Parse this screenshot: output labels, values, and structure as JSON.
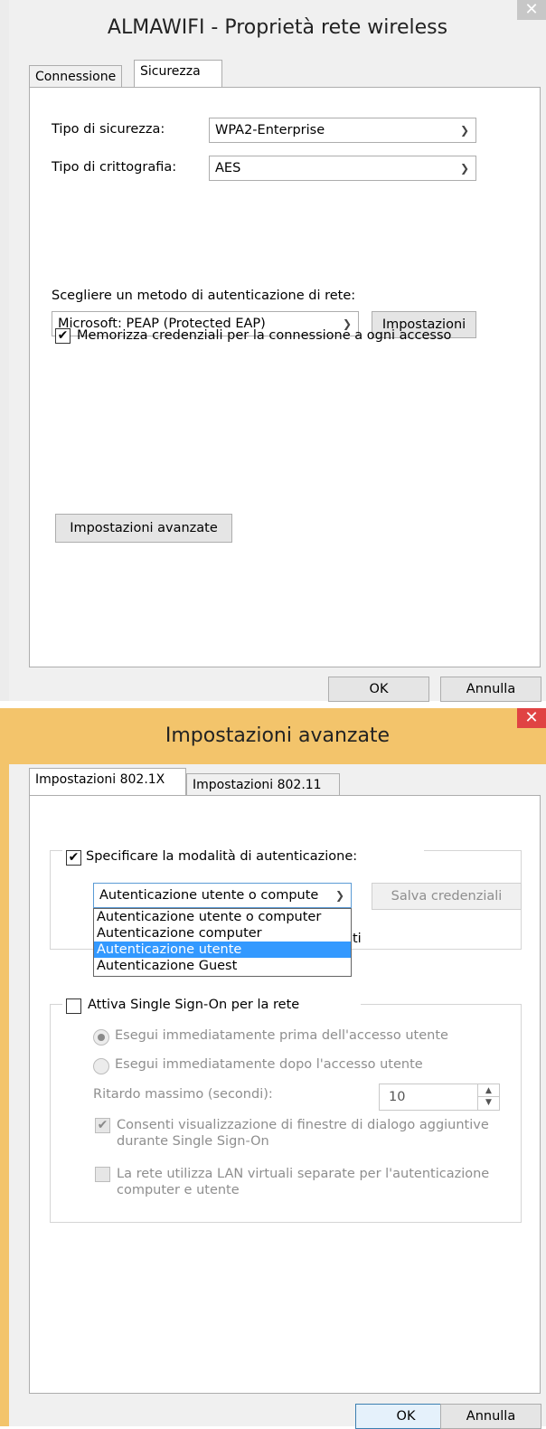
{
  "dialog1": {
    "title": "ALMAWIFI - Proprietà rete wireless",
    "tabs": [
      "Connessione",
      "Sicurezza"
    ],
    "security_type_label": "Tipo di sicurezza:",
    "security_type_value": "WPA2-Enterprise",
    "encryption_type_label": "Tipo di crittografia:",
    "encryption_type_value": "AES",
    "auth_method_label": "Scegliere un metodo di autenticazione di rete:",
    "auth_method_value": "Microsoft: PEAP (Protected EAP)",
    "settings_button": "Impostazioni",
    "remember_credentials_label": "Memorizza credenziali per la connessione a ogni accesso",
    "remember_credentials_checked": true,
    "advanced_settings_button": "Impostazioni avanzate",
    "ok_button": "OK",
    "cancel_button": "Annulla"
  },
  "dialog2": {
    "title": "Impostazioni avanzate",
    "tabs": [
      "Impostazioni 802.1X",
      "Impostazioni 802.11"
    ],
    "specify_auth_mode_label": "Specificare la modalità di autenticazione:",
    "specify_auth_mode_checked": true,
    "auth_mode_value": "Autenticazione utente o compute",
    "save_credentials_button": "Salva credenziali",
    "auth_mode_options": [
      "Autenticazione utente o computer",
      "Autenticazione computer",
      "Autenticazione utente",
      "Autenticazione Guest"
    ],
    "auth_mode_highlighted": "Autenticazione utente",
    "obscured_text_fragment": "ti",
    "sso_label": "Attiva Single Sign-On per la rete",
    "sso_checked": false,
    "sso_before_label": "Esegui immediatamente prima dell'accesso utente",
    "sso_after_label": "Esegui immediatamente dopo l'accesso utente",
    "max_delay_label": "Ritardo massimo (secondi):",
    "max_delay_value": "10",
    "allow_dialogs_label": "Consenti visualizzazione di finestre di dialogo aggiuntive durante Single Sign-On",
    "allow_dialogs_checked": true,
    "separate_vlans_label": "La rete utilizza LAN virtuali separate per l'autenticazione computer e utente",
    "separate_vlans_checked": false,
    "ok_button": "OK",
    "cancel_button": "Annulla"
  },
  "colors": {
    "dialog2_accent": "#f3c46b",
    "close_active": "#e04343",
    "selection": "#3399ff"
  },
  "icons": [
    "close-icon",
    "checkmark-icon",
    "chevron-down-icon",
    "spin-up-icon",
    "spin-down-icon"
  ]
}
